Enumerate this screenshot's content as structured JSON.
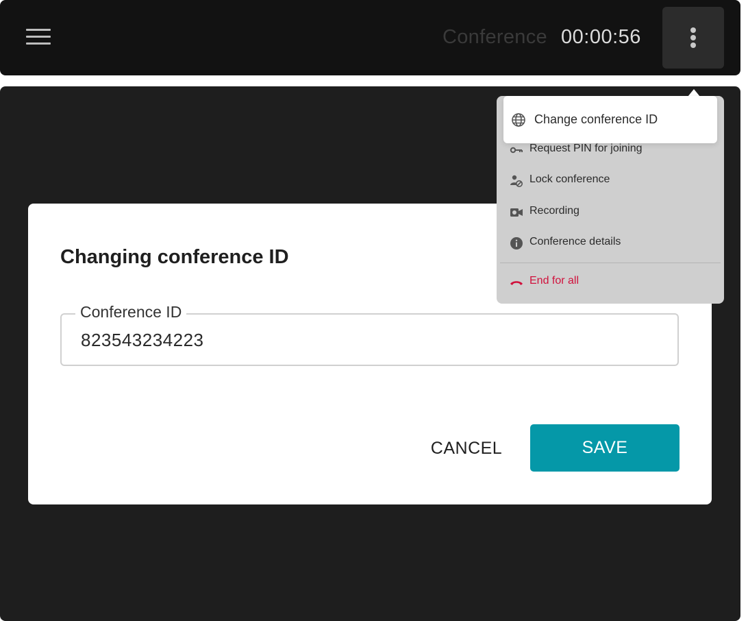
{
  "header": {
    "menu_icon": "hamburger-menu-icon",
    "title": "Conference",
    "timer": "00:00:56",
    "more_icon": "more-vertical-icon"
  },
  "dialog": {
    "title": "Changing conference ID",
    "field_label": "Conference ID",
    "field_value": "823543234223",
    "cancel_label": "CANCEL",
    "save_label": "SAVE"
  },
  "menu": {
    "items": [
      {
        "label": "Change conference ID",
        "icon": "globe-icon"
      },
      {
        "label": "Request PIN for joining",
        "icon": "key-icon"
      },
      {
        "label": "Lock conference",
        "icon": "user-block-icon"
      },
      {
        "label": "Recording",
        "icon": "video-camera-icon"
      },
      {
        "label": "Conference details",
        "icon": "info-icon"
      },
      {
        "label": "End for all",
        "icon": "phone-hangup-icon"
      }
    ]
  },
  "colors": {
    "accent": "#0598a8",
    "danger": "#d0113c",
    "topbar": "#121212",
    "background": "#1e1e1e"
  }
}
